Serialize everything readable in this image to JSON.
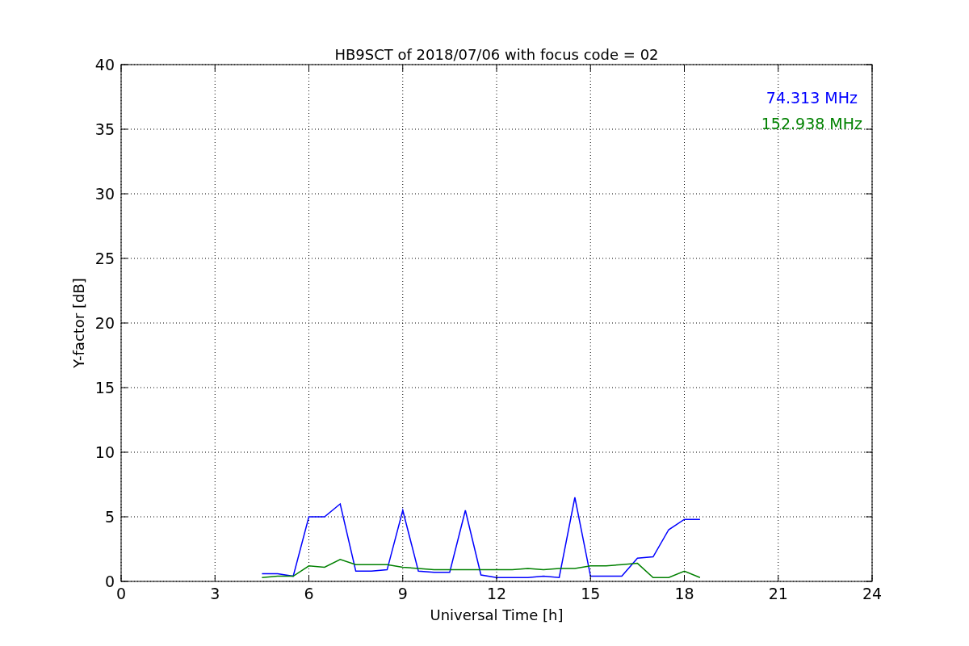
{
  "figure": {
    "chart_data": {
      "type": "line",
      "title": "HB9SCT of 2018/07/06 with focus code = 02",
      "xlabel": "Universal Time [h]",
      "ylabel": "Y-factor [dB]",
      "x": [
        4.5,
        5,
        5.5,
        6,
        6.5,
        7,
        7.5,
        8,
        8.5,
        9,
        9.5,
        10,
        10.5,
        11,
        11.5,
        12,
        12.5,
        13,
        13.5,
        14,
        14.5,
        15,
        15.5,
        16,
        16.5,
        17,
        17.5,
        18,
        18.5
      ],
      "series": [
        {
          "name": "74.313 MHz",
          "color": "#0000ff",
          "values": [
            0.6,
            0.6,
            0.4,
            5.0,
            5.0,
            6.0,
            0.8,
            0.8,
            0.9,
            5.5,
            0.8,
            0.7,
            0.7,
            5.5,
            0.5,
            0.3,
            0.3,
            0.3,
            0.4,
            0.3,
            6.5,
            0.4,
            0.4,
            0.4,
            1.8,
            1.9,
            4.0,
            4.8,
            4.8
          ]
        },
        {
          "name": "152.938 MHz",
          "color": "#008000",
          "values": [
            0.3,
            0.4,
            0.4,
            1.2,
            1.1,
            1.7,
            1.3,
            1.3,
            1.3,
            1.1,
            1.0,
            0.9,
            0.9,
            0.9,
            0.9,
            0.9,
            0.9,
            1.0,
            0.9,
            1.0,
            1.0,
            1.2,
            1.2,
            1.3,
            1.4,
            0.3,
            0.3,
            0.8,
            0.3
          ]
        }
      ],
      "grid": true,
      "xlim": [
        0,
        24
      ],
      "ylim": [
        0,
        40
      ],
      "xticks": [
        0,
        3,
        6,
        9,
        12,
        15,
        18,
        21,
        24
      ],
      "yticks": [
        0,
        5,
        10,
        15,
        20,
        25,
        30,
        35,
        40
      ]
    }
  }
}
